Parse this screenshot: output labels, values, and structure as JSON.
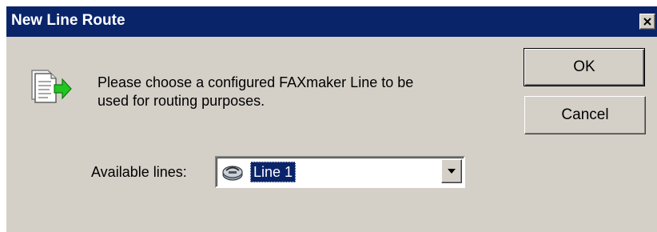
{
  "window": {
    "title": "New Line Route",
    "close_icon": "close-icon",
    "title_bar_color": "#0a246a",
    "face_color": "#d4d0c8"
  },
  "message": {
    "icon": "document-arrow-icon",
    "line1": "Please choose a configured FAXmaker Line to be",
    "line2": "used for routing purposes."
  },
  "buttons": {
    "ok_label": "OK",
    "cancel_label": "Cancel"
  },
  "lines": {
    "label": "Available lines:",
    "selected": "Line 1",
    "item_icon": "fax-line-icon",
    "dropdown_icon": "chevron-down-icon"
  }
}
